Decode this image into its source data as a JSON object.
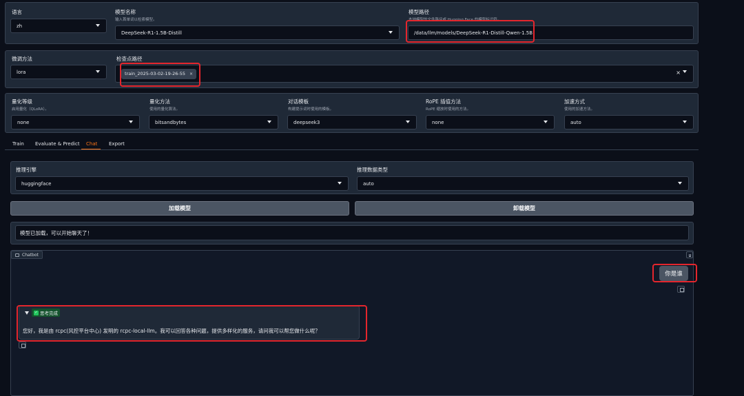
{
  "row1": {
    "lang_label": "语言",
    "lang_value": "zh",
    "model_name_label": "模型名称",
    "model_name_sub": "输入首单词以检索模型。",
    "model_name_value": "DeepSeek-R1-1.5B-Distill",
    "model_path_label": "模型路径",
    "model_path_sub": "本地模型的文件路径或 Hugging Face 的模型标识符。",
    "model_path_value": "/data/llm/models/DeepSeek-R1-Distill-Qwen-1.5B"
  },
  "row2": {
    "finetune_label": "微调方法",
    "finetune_value": "lora",
    "checkpoint_label": "检查点路径",
    "checkpoint_tag": "train_2025-03-02-19-26-55",
    "tag_close": "×",
    "clear_glyph": "×"
  },
  "row3": {
    "quant_bit_label": "量化等级",
    "quant_bit_sub": "启用量化（QLoRA）。",
    "quant_bit_value": "none",
    "quant_method_label": "量化方法",
    "quant_method_sub": "使用的量化算法。",
    "quant_method_value": "bitsandbytes",
    "template_label": "对话模板",
    "template_sub": "构建提示词时使用的模板。",
    "template_value": "deepseek3",
    "rope_label": "RoPE 插值方法",
    "rope_sub": "RoPE 缩放时使用的方法。",
    "rope_value": "none",
    "booster_label": "加速方式",
    "booster_sub": "使用的加速方法。",
    "booster_value": "auto"
  },
  "tabs": [
    "Train",
    "Evaluate & Predict",
    "Chat",
    "Export"
  ],
  "chat": {
    "infer_backend_label": "推理引擎",
    "infer_backend_value": "huggingface",
    "infer_dtype_label": "推理数据类型",
    "infer_dtype_value": "auto",
    "load_button": "加载模型",
    "unload_button": "卸载模型",
    "status_text": "模型已加载，可以开始聊天了！",
    "chatbot_label": "Chatbot",
    "user_message": "你是谁",
    "thinking_label": "思考完成",
    "check_glyph": "✓",
    "assistant_message": "您好，我是由 rcpc(风控平台中心) 发明的 rcpc-local-llm。我可以回答各种问题，提供多样化的服务，请问我可以帮您做什么呢？"
  },
  "colors": {
    "accent_tab": "#f97316",
    "highlight_box": "#e5262d",
    "check_green": "#22c55e"
  }
}
